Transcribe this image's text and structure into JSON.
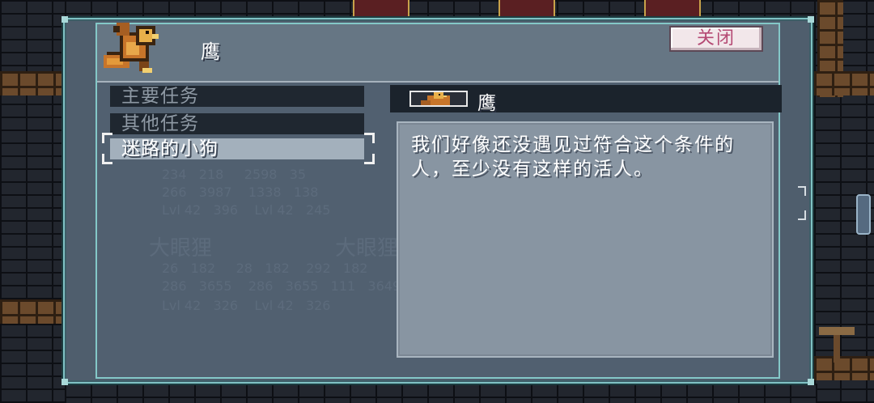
{
  "header": {
    "title": "鹰",
    "close_label": "关闭"
  },
  "quest_list": {
    "main_quests_label": "主要任务",
    "other_quests_label": "其他任务",
    "selected_quest_label": "迷路的小狗"
  },
  "detail": {
    "name": "鹰",
    "description": "我们好像还没遇见过符合这个条件的人，至少没有这样的活人。"
  },
  "colors": {
    "accent_border": "#7fc2c4",
    "close_text": "#b54a74",
    "panel_bg": "#8895a2"
  }
}
